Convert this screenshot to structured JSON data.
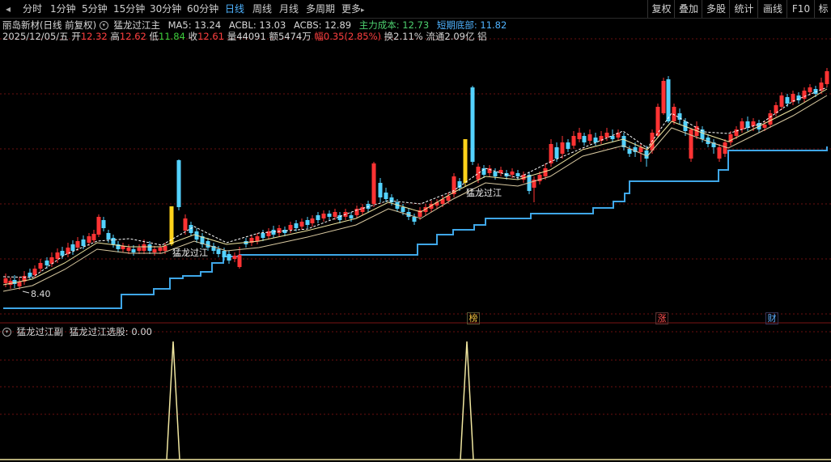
{
  "toolbar": {
    "left_icon": "collapse-icon",
    "periods": [
      "分时",
      "1分钟",
      "5分钟",
      "15分钟",
      "30分钟",
      "60分钟",
      "日线",
      "周线",
      "月线",
      "多周期",
      "更多"
    ],
    "more_arrow": "▸",
    "active_index": 6,
    "right_buttons": [
      "复权",
      "叠加",
      "多股",
      "统计",
      "画线",
      "F10",
      "标"
    ]
  },
  "main_panel": {
    "stock_name": "丽岛新材(日线 前复权)",
    "indicator_name": "猛龙过江主",
    "ma5_label": "MA5: 13.24",
    "acbl_label": "ACBL: 13.03",
    "acbs_label": "ACBS: 12.89",
    "main_cost_label": "主力成本: 12.73",
    "short_bottom_label": "短期底部: 11.82",
    "date": "2025/12/05/五",
    "open_label": "开",
    "open_value": "12.32",
    "high_label": "高",
    "high_value": "12.62",
    "low_label": "低",
    "low_value": "11.84",
    "close_label": "收",
    "close_value": "12.61",
    "volume_label": "量",
    "volume_value": "44091",
    "amount_label": "额",
    "amount_value": "5474万",
    "change_label": "幅",
    "change_value": "0.35(2.85%)",
    "turnover_label": "换",
    "turnover_value": "2.11%",
    "float_label": "流通",
    "float_value": "2.09亿",
    "sector": "铝",
    "low_price_label": "8.40",
    "signal_labels": [
      "猛龙过江",
      "猛龙过江"
    ],
    "event_markers": [
      "榜",
      "涨",
      "财"
    ]
  },
  "sub_panel": {
    "indicator_name": "猛龙过江副",
    "selection_label": "猛龙过江选股: 0.00"
  },
  "colors": {
    "up": "#ff3333",
    "down": "#54d2ff",
    "signal": "#ffd21a",
    "support_line": "#3fa7e8",
    "ma_line": "#f0e6a0",
    "dash_line": "#ffffff",
    "grid": "#6b1010"
  }
}
